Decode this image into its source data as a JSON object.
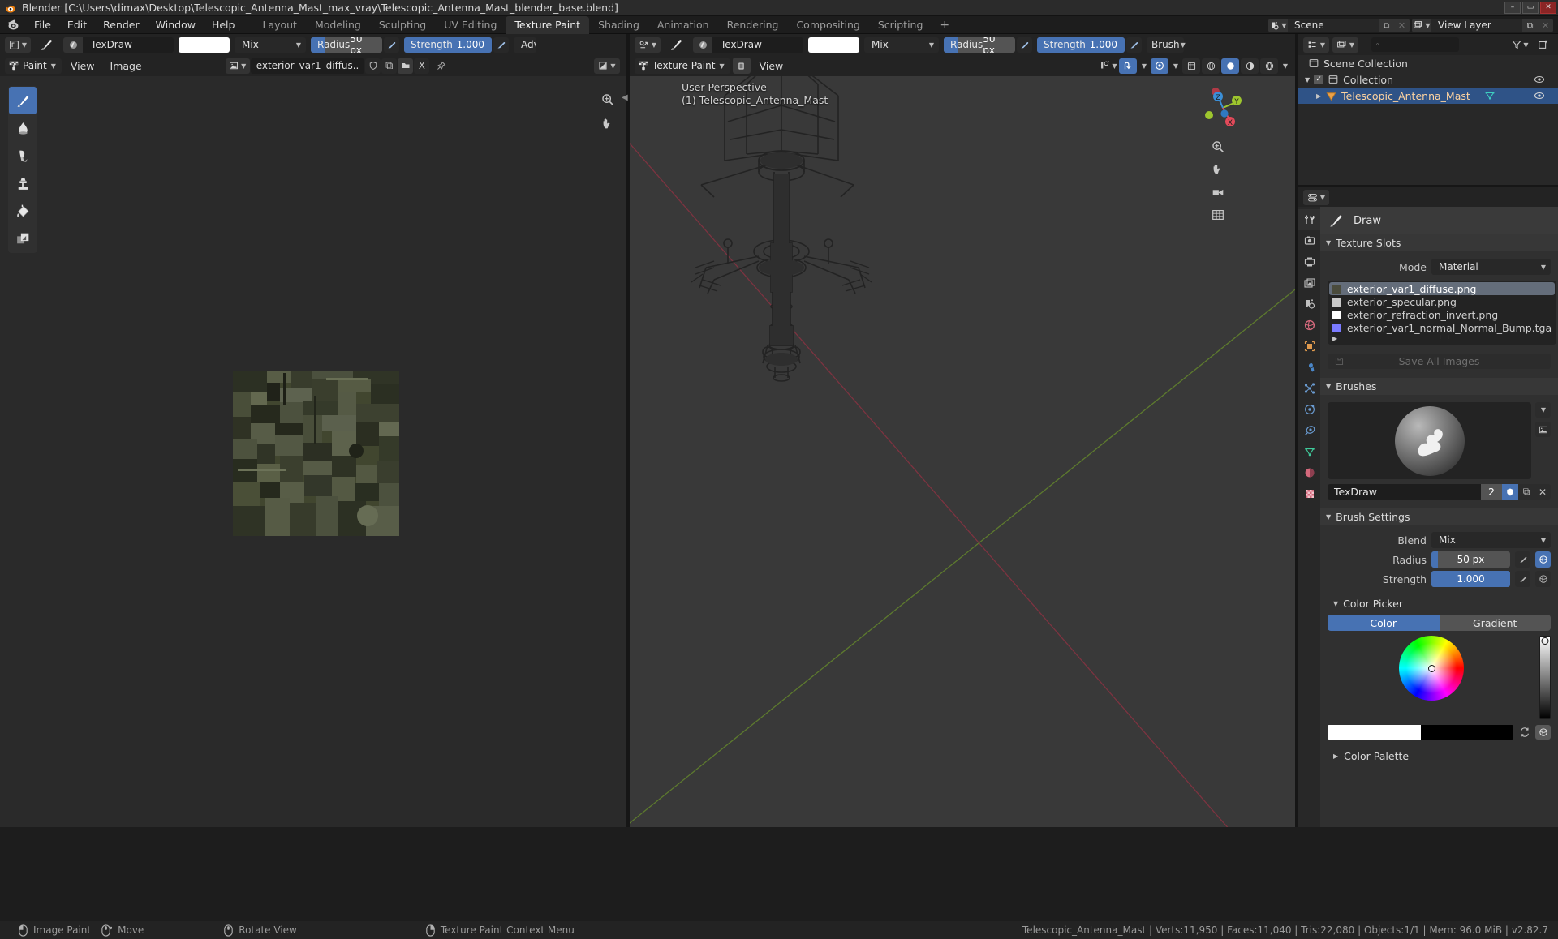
{
  "window": {
    "title": "Blender [C:\\Users\\dimax\\Desktop\\Telescopic_Antenna_Mast_max_vray\\Telescopic_Antenna_Mast_blender_base.blend]",
    "minimize": "–",
    "maximize": "▭",
    "close": "✕"
  },
  "topbar": {
    "menus": [
      "File",
      "Edit",
      "Render",
      "Window",
      "Help"
    ],
    "workspaces": [
      {
        "label": "Layout",
        "active": false
      },
      {
        "label": "Modeling",
        "active": false
      },
      {
        "label": "Sculpting",
        "active": false
      },
      {
        "label": "UV Editing",
        "active": false
      },
      {
        "label": "Texture Paint",
        "active": true
      },
      {
        "label": "Shading",
        "active": false
      },
      {
        "label": "Animation",
        "active": false
      },
      {
        "label": "Rendering",
        "active": false
      },
      {
        "label": "Compositing",
        "active": false
      },
      {
        "label": "Scripting",
        "active": false
      }
    ],
    "add_workspace": "+",
    "scene_name": "Scene",
    "view_layer_name": "View Layer",
    "new_copy": "⧉",
    "unlink": "✕"
  },
  "image_editor": {
    "header_row1": {
      "brush_name": "TexDraw",
      "color_swatch": "#ffffff",
      "blend": "Mix",
      "radius_label": "Radius",
      "radius_value": "50 px",
      "radius_fill_pct": 20,
      "strength_label": "Strength",
      "strength_value": "1.000",
      "strength_fill_pct": 100,
      "advanced_label": "Adva"
    },
    "header_row2": {
      "mode": "Paint",
      "menus": [
        "View",
        "Image"
      ],
      "image_name": "exterior_var1_diffus..",
      "pin_icon": "pin-icon"
    },
    "tools": [
      {
        "name": "draw-tool",
        "active": true
      },
      {
        "name": "soften-tool",
        "active": false
      },
      {
        "name": "smear-tool",
        "active": false
      },
      {
        "name": "clone-tool",
        "active": false
      },
      {
        "name": "fill-tool",
        "active": false
      },
      {
        "name": "mask-tool",
        "active": false
      }
    ]
  },
  "viewport": {
    "header_row1": {
      "brush_name": "TexDraw",
      "color_swatch": "#ffffff",
      "blend": "Mix",
      "radius_label": "Radius",
      "radius_value": "50 px",
      "radius_fill_pct": 20,
      "strength_label": "Strength",
      "strength_value": "1.000",
      "strength_fill_pct": 100,
      "brush_menu": "Brush"
    },
    "header_row2": {
      "mode": "Texture Paint",
      "menus": [
        "View"
      ]
    },
    "overlay_line1": "User Perspective",
    "overlay_line2": "(1) Telescopic_Antenna_Mast",
    "gizmo_axes": [
      "X",
      "Y",
      "Z"
    ],
    "bg_color": "#393939"
  },
  "outliner": {
    "search_placeholder": "",
    "rows": [
      {
        "label": "Scene Collection",
        "indent": 0,
        "selected": false,
        "icon": "collection-icon",
        "has_eye": false,
        "has_check": false,
        "disclosure": ""
      },
      {
        "label": "Collection",
        "indent": 1,
        "selected": false,
        "icon": "collection-icon",
        "has_eye": true,
        "has_check": true,
        "disclosure": "▼"
      },
      {
        "label": "Telescopic_Antenna_Mast",
        "indent": 2,
        "selected": true,
        "icon": "mesh-object-icon",
        "has_eye": true,
        "has_check": false,
        "disclosure": "▶"
      }
    ]
  },
  "properties": {
    "tool_title": "Draw",
    "sections": {
      "texture_slots": {
        "title": "Texture Slots",
        "mode_label": "Mode",
        "mode_value": "Material",
        "slots": [
          {
            "name": "exterior_var1_diffuse.png",
            "selected": true,
            "swatch": "#4a4b3c"
          },
          {
            "name": "exterior_specular.png",
            "selected": false,
            "swatch": "#c9c9c9"
          },
          {
            "name": "exterior_refraction_invert.png",
            "selected": false,
            "swatch": "#ffffff"
          },
          {
            "name": "exterior_var1_normal_Normal_Bump.tga",
            "selected": false,
            "swatch": "#7b7bff"
          }
        ],
        "add_button": "+",
        "save_all_images": "Save All Images"
      },
      "brushes": {
        "title": "Brushes",
        "brush_name": "TexDraw",
        "users_count": "2",
        "fake_user_icon": "shield-icon",
        "new_copy_icon": "duplicate-icon",
        "unlink_icon": "✕"
      },
      "brush_settings": {
        "title": "Brush Settings",
        "blend_label": "Blend",
        "blend_value": "Mix",
        "radius_label": "Radius",
        "radius_value": "50 px",
        "radius_fill_pct": 8,
        "strength_label": "Strength",
        "strength_value": "1.000",
        "strength_fill_pct": 100
      },
      "color_picker": {
        "title": "Color Picker",
        "tab_color": "Color",
        "tab_gradient": "Gradient",
        "active_tab": "Color",
        "primary_color": "#ffffff",
        "secondary_color": "#000000",
        "value": 1.0
      },
      "color_palette": {
        "title": "Color Palette",
        "collapsed": true
      }
    },
    "tabs": [
      {
        "name": "tool-tab",
        "active": true
      },
      {
        "name": "render-tab",
        "active": false
      },
      {
        "name": "output-tab",
        "active": false
      },
      {
        "name": "view-layer-tab",
        "active": false
      },
      {
        "name": "scene-tab",
        "active": false
      },
      {
        "name": "world-tab",
        "active": false
      },
      {
        "name": "object-tab",
        "active": false
      },
      {
        "name": "modifier-tab",
        "active": false
      },
      {
        "name": "particles-tab",
        "active": false
      },
      {
        "name": "physics-tab",
        "active": false
      },
      {
        "name": "constraints-tab",
        "active": false
      },
      {
        "name": "object-data-tab",
        "active": false
      },
      {
        "name": "material-tab",
        "active": false
      },
      {
        "name": "texture-tab",
        "active": false
      }
    ]
  },
  "statusbar": {
    "keymap": [
      {
        "icon": "mouse-left-icon",
        "label": "Image Paint"
      },
      {
        "icon": "mouse-middle-icon",
        "label": "Move"
      },
      {
        "icon": "mouse-middle-icon",
        "label": "Rotate View"
      },
      {
        "icon": "mouse-right-icon",
        "label": "Texture Paint Context Menu"
      }
    ],
    "stats": "Telescopic_Antenna_Mast | Verts:11,950 | Faces:11,040 | Tris:22,080 | Objects:1/1 | Mem: 96.0 MiB | v2.82.7"
  }
}
